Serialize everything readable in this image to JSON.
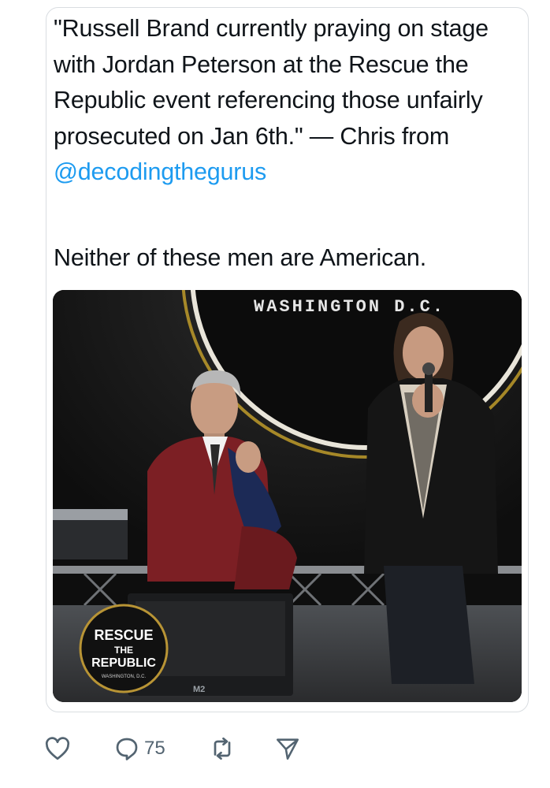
{
  "tweet": {
    "quote_text": "\"Russell Brand currently praying on stage with Jordan Peterson at the Rescue the Republic event referencing those unfairly prosecuted on Jan 6th.\" — Chris from",
    "mention": "@decodingthegurus",
    "comment": "Neither of these men are American."
  },
  "media": {
    "backdrop_text": "WASHINGTON D.C.",
    "logo_line1": "RESCUE",
    "logo_line2": "THE",
    "logo_line3": "REPUBLIC",
    "logo_sub": "WASHINGTON, D.C.",
    "speaker_label": "M2"
  },
  "actions": {
    "reply_count": "75"
  },
  "colors": {
    "text": "#0f1419",
    "link": "#1d9bf0",
    "icon": "#536471"
  }
}
